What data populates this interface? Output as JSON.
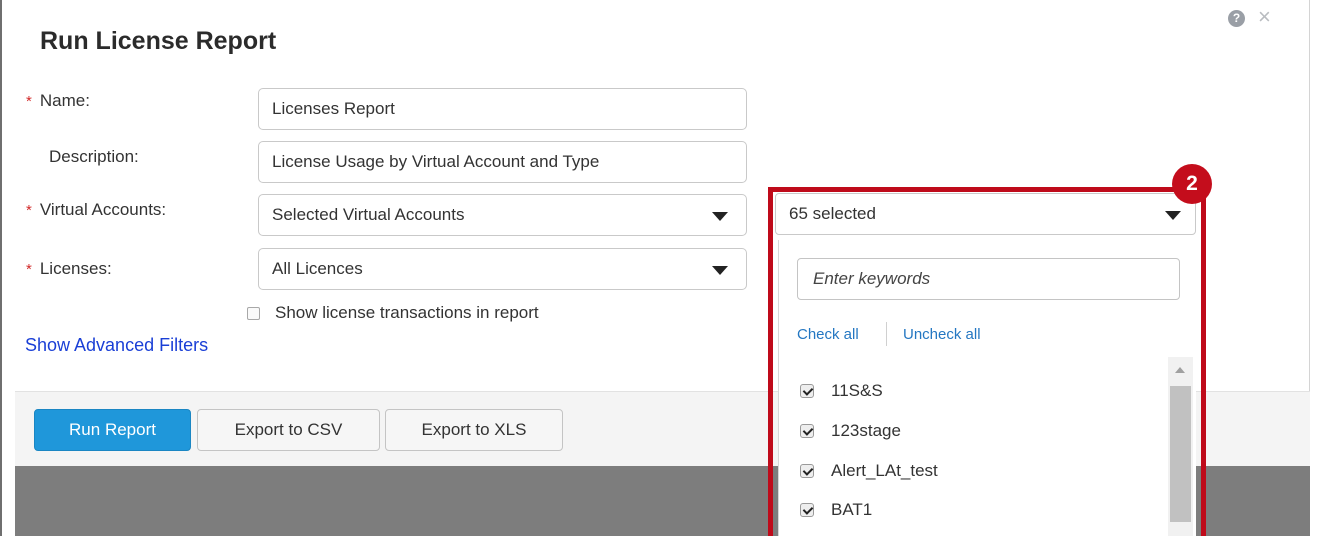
{
  "dialog": {
    "title": "Run License Report",
    "help_icon": "question-circle-icon",
    "help_glyph": "?",
    "close_icon": "close-icon",
    "close_glyph": "×"
  },
  "form": {
    "required_mark": "*",
    "name": {
      "label": "Name:",
      "value": "Licenses Report"
    },
    "description": {
      "label": "Description:",
      "value": "License Usage by Virtual Account and Type"
    },
    "virtual_accounts": {
      "label": "Virtual Accounts:",
      "value": "Selected Virtual Accounts"
    },
    "licenses": {
      "label": "Licenses:",
      "value": "All Licences"
    },
    "show_transactions": {
      "label": "Show license transactions in report",
      "checked": false
    },
    "advanced_filters_link": "Show Advanced Filters"
  },
  "footer": {
    "run_report": "Run Report",
    "export_csv": "Export to CSV",
    "export_xls": "Export to XLS"
  },
  "account_picker": {
    "summary": "65 selected",
    "badge": "2",
    "search_placeholder": "Enter keywords",
    "check_all": "Check all",
    "uncheck_all": "Uncheck all",
    "items": [
      {
        "label": "11S&S",
        "checked": true
      },
      {
        "label": "123stage",
        "checked": true
      },
      {
        "label": "Alert_LAt_test",
        "checked": true
      },
      {
        "label": "BAT1",
        "checked": true
      }
    ]
  },
  "colors": {
    "primary_button": "#1f97da",
    "highlight": "#bf0a1a",
    "required": "#d22a2a",
    "link": "#1a3fd6"
  }
}
